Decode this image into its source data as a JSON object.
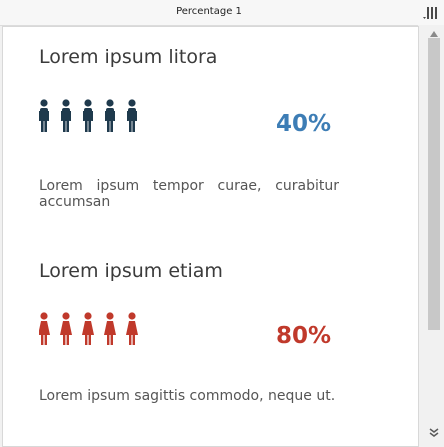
{
  "window": {
    "title": "Percentage 1"
  },
  "sections": [
    {
      "title": "Lorem ipsum litora",
      "percent_label": "40%",
      "percent_value": 40,
      "icon_count": 5,
      "color": "#3d7db5",
      "description": "Lorem ipsum tempor curae, curabitur accumsan"
    },
    {
      "title": "Lorem ipsum etiam",
      "percent_label": "80%",
      "percent_value": 80,
      "icon_count": 5,
      "color": "#c0392b",
      "description": "Lorem ipsum sagittis commodo, neque ut."
    }
  ],
  "colors": {
    "male_icon": "#1f3a4d",
    "female_icon": "#c0392b",
    "percent_blue": "#3d7db5",
    "percent_red": "#c0392b"
  },
  "icons": {
    "menu": "vertical-bars-icon",
    "scroll_up": "triangle-up-icon",
    "scroll_down": "double-chevron-down-icon",
    "male": "male-person-icon",
    "female": "female-person-icon"
  }
}
